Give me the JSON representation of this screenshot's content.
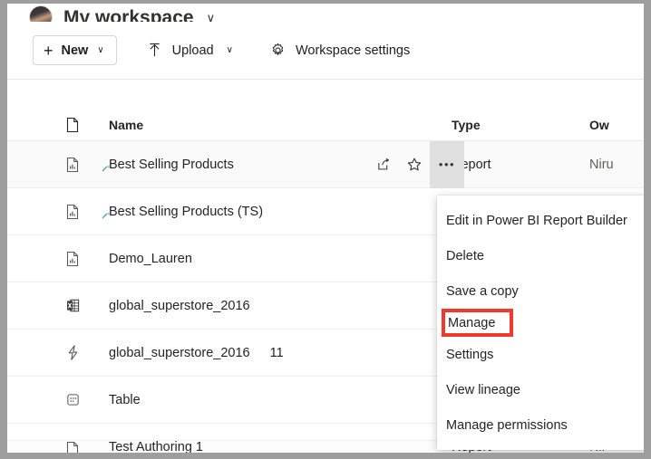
{
  "workspace": {
    "title": "My workspace",
    "chevron": "∨",
    "avatar_label": "user-avatar"
  },
  "commandbar": {
    "new_button": {
      "label": "New",
      "plus": "+",
      "chevron": "∨"
    },
    "upload": {
      "label": "Upload",
      "chevron": "∨",
      "icon": "upload-icon"
    },
    "workspace_settings": {
      "label": "Workspace settings",
      "icon": "gear-icon"
    }
  },
  "list": {
    "headers": {
      "icon_col": "file-type-icon",
      "name": "Name",
      "type": "Type",
      "owner": "Ow"
    },
    "rows": [
      {
        "name": "Best Selling Products",
        "icon": "paginated-report-icon",
        "endorsed": true,
        "count": "",
        "type": "Report",
        "owner": "Niru",
        "active": true,
        "actions": {
          "share": "share-icon",
          "favorite": "star-icon",
          "more": "•••"
        }
      },
      {
        "name": "Best Selling Products (TS)",
        "icon": "paginated-report-icon",
        "endorsed": true,
        "count": "",
        "type": "",
        "owner": "",
        "active": false
      },
      {
        "name": "Demo_Lauren",
        "icon": "paginated-report-icon",
        "endorsed": false,
        "count": "",
        "type": "",
        "owner": "",
        "active": false
      },
      {
        "name": "global_superstore_2016",
        "icon": "excel-workbook-icon",
        "endorsed": false,
        "count": "",
        "type": "",
        "owner": "",
        "active": false
      },
      {
        "name": "global_superstore_2016",
        "icon": "dataflow-icon",
        "endorsed": false,
        "count": "11",
        "type": "",
        "owner": "",
        "active": false
      },
      {
        "name": "Table",
        "icon": "dataset-icon",
        "endorsed": false,
        "count": "",
        "type": "",
        "owner": "",
        "active": false
      }
    ],
    "clipped_row": {
      "name": "Test Authoring 1",
      "icon": "paginated-report-icon",
      "type": "Report",
      "owner": "Nir"
    }
  },
  "context_menu": {
    "items": [
      {
        "label": "Edit in Power BI Report Builder",
        "highlighted": false
      },
      {
        "label": "Delete",
        "highlighted": false
      },
      {
        "label": "Save a copy",
        "highlighted": false
      },
      {
        "label": "Manage",
        "highlighted": true
      },
      {
        "label": "Settings",
        "highlighted": false
      },
      {
        "label": "View lineage",
        "highlighted": false
      },
      {
        "label": "Manage permissions",
        "highlighted": false
      }
    ]
  },
  "colors": {
    "highlight_box": "#f03a2e",
    "endorsement_badge": "#4fa9a3",
    "frame": "#9e9e9e",
    "active_cell": "#e0e0e0",
    "excel_green": "#217346"
  }
}
